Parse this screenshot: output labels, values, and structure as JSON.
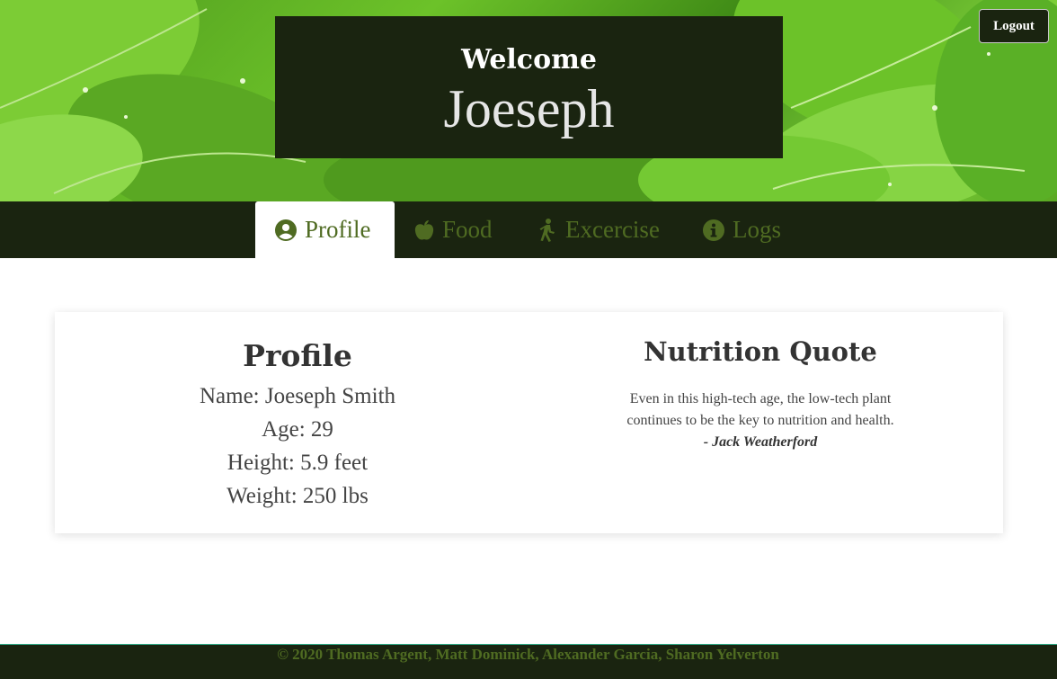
{
  "header": {
    "welcome_label": "Welcome",
    "user_name": "Joeseph",
    "logout_label": "Logout"
  },
  "nav": {
    "tabs": [
      {
        "label": "Profile",
        "icon": "user-circle-icon",
        "active": true
      },
      {
        "label": "Food",
        "icon": "apple-icon",
        "active": false
      },
      {
        "label": "Excercise",
        "icon": "walking-icon",
        "active": false
      },
      {
        "label": "Logs",
        "icon": "info-circle-icon",
        "active": false
      }
    ]
  },
  "profile": {
    "heading": "Profile",
    "name_line": "Name: Joeseph Smith",
    "age_line": "Age: 29",
    "height_line": "Height: 5.9 feet",
    "weight_line": "Weight: 250 lbs"
  },
  "quote": {
    "heading": "Nutrition Quote",
    "text": "Even in this high-tech age, the low-tech plant continues to be the key to nutrition and health.",
    "author": "- Jack Weatherford"
  },
  "footer": {
    "copyright": "© 2020 Thomas Argent, Matt Dominick, Alexander Garcia, Sharon Yelverton"
  },
  "colors": {
    "dark_green": "#1a2410",
    "tab_text": "#4f6b22",
    "leaf_green": "#6cc229",
    "footer_border": "#2fae8a"
  }
}
